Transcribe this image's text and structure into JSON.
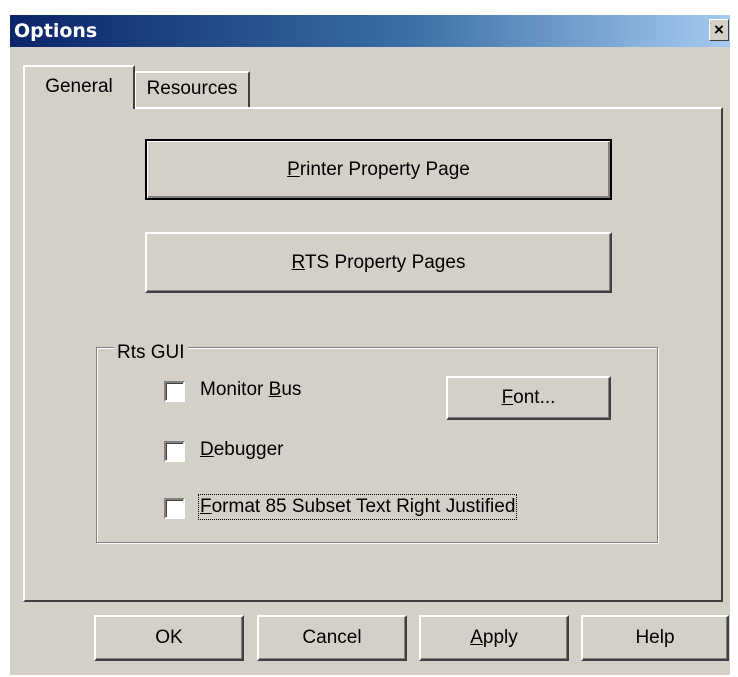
{
  "window": {
    "title": "Options",
    "close_symbol": "×"
  },
  "tabs": [
    {
      "label": "General",
      "selected": true
    },
    {
      "label": "Resources",
      "selected": false
    }
  ],
  "main_buttons": {
    "printer": {
      "mnemonic": "P",
      "rest": "rinter Property Page"
    },
    "rts": {
      "mnemonic": "R",
      "rest": "TS Property Pages"
    }
  },
  "group": {
    "title": "Rts GUI",
    "checkboxes": [
      {
        "before": "Monitor ",
        "mnemonic": "B",
        "rest": "us",
        "checked": false
      },
      {
        "before": "",
        "mnemonic": "D",
        "rest": "ebugger",
        "checked": false
      },
      {
        "before": "",
        "mnemonic": "F",
        "rest": "ormat 85 Subset Text Right Justified",
        "checked": false
      }
    ],
    "font_button": {
      "mnemonic": "F",
      "rest": "ont..."
    }
  },
  "footer": {
    "ok": "OK",
    "cancel": "Cancel",
    "apply": {
      "mnemonic": "A",
      "rest": "pply"
    },
    "help": "Help"
  }
}
